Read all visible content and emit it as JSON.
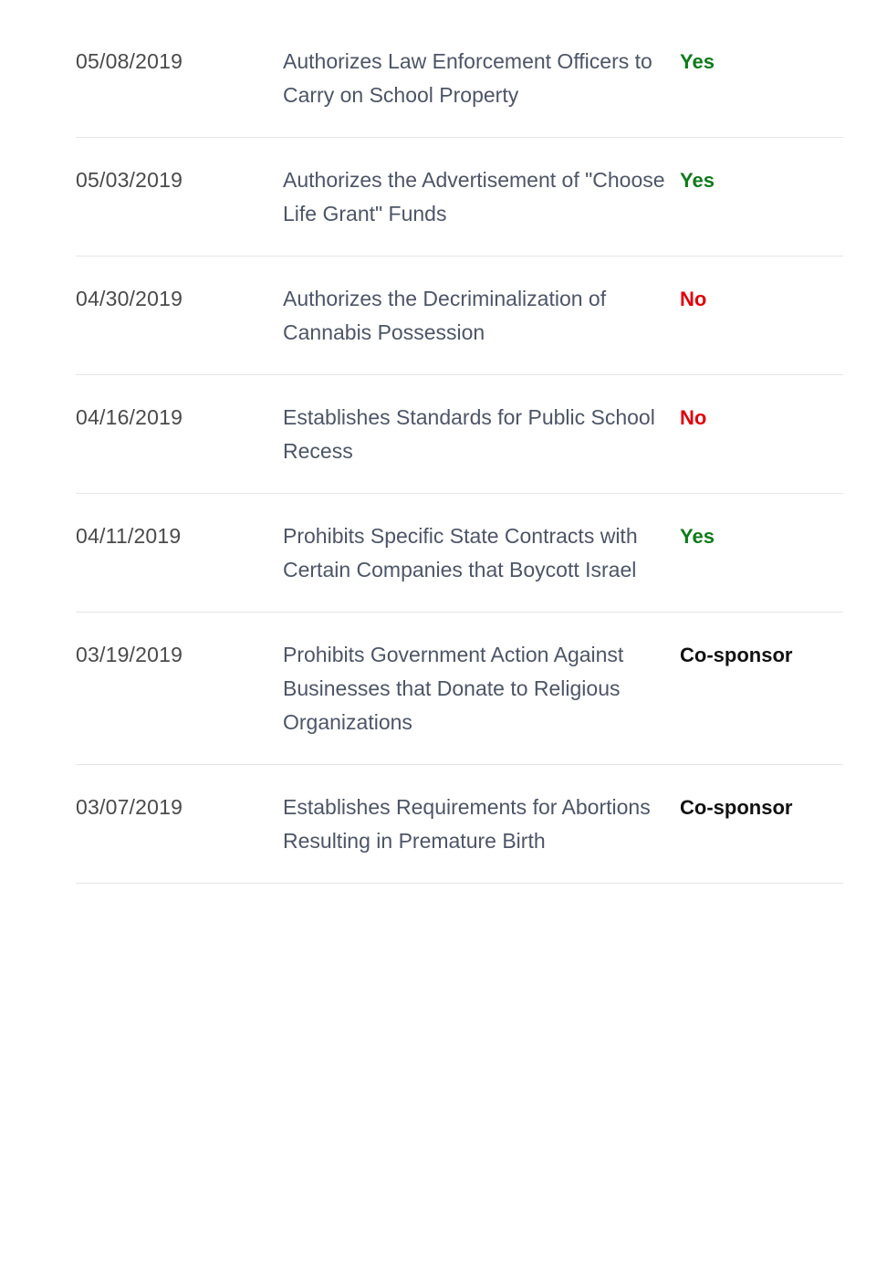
{
  "votes": [
    {
      "date": "05/08/2019",
      "title": "Authorizes Law Enforcement Officers to Carry on School Property",
      "vote": "Yes",
      "vote_type": "yes"
    },
    {
      "date": "05/03/2019",
      "title": "Authorizes the Advertisement of \"Choose Life Grant\" Funds",
      "vote": "Yes",
      "vote_type": "yes"
    },
    {
      "date": "04/30/2019",
      "title": "Authorizes the Decriminalization of Cannabis Possession",
      "vote": "No",
      "vote_type": "no"
    },
    {
      "date": "04/16/2019",
      "title": "Establishes Standards for Public School Recess",
      "vote": "No",
      "vote_type": "no"
    },
    {
      "date": "04/11/2019",
      "title": "Prohibits Specific State Contracts with Certain Companies that Boycott Israel",
      "vote": "Yes",
      "vote_type": "yes"
    },
    {
      "date": "03/19/2019",
      "title": "Prohibits Government Action Against Businesses that Donate to Religious Organizations",
      "vote": "Co-sponsor",
      "vote_type": "cosponsor"
    },
    {
      "date": "03/07/2019",
      "title": "Establishes Requirements for Abortions Resulting in Premature Birth",
      "vote": "Co-sponsor",
      "vote_type": "cosponsor"
    }
  ],
  "colors": {
    "yes": "#0f7a1a",
    "no": "#e0000a",
    "cosponsor": "#111111"
  }
}
